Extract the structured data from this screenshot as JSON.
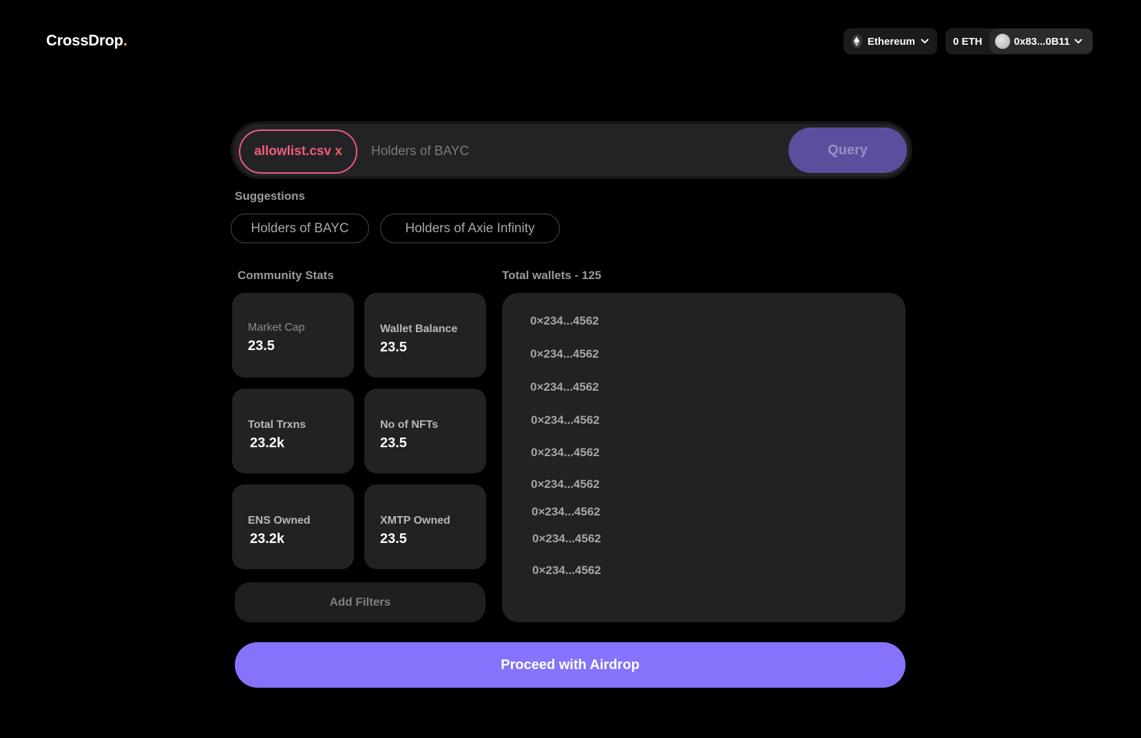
{
  "header": {
    "logo_text": "CrossDrop",
    "logo_dot": ".",
    "network_label": "Ethereum",
    "balance": "0 ETH",
    "wallet_address": "0x83...0B11"
  },
  "search": {
    "file_chip": "allowlist.csv x",
    "placeholder": "Holders of BAYC",
    "value": "",
    "query_label": "Query"
  },
  "suggestions": {
    "title": "Suggestions",
    "items": [
      "Holders of BAYC",
      "Holders of Axie Infinity"
    ]
  },
  "stats": {
    "title": "Community Stats",
    "cards": [
      {
        "label": "Market Cap",
        "value": "23.5"
      },
      {
        "label": "Wallet Balance",
        "value": "23.5"
      },
      {
        "label": "Total Trxns",
        "value": "23.2k"
      },
      {
        "label": "No of NFTs",
        "value": "23.5"
      },
      {
        "label": "ENS Owned",
        "value": "23.2k"
      },
      {
        "label": "XMTP Owned",
        "value": "23.5"
      }
    ],
    "add_filters_label": "Add Filters"
  },
  "wallets": {
    "title": "Total wallets - 125",
    "items": [
      "0×234...4562",
      "0×234...4562",
      "0×234...4562",
      "0×234...4562",
      "0×234...4562",
      "0×234...4562",
      "0×234...4562",
      "0×234...4562",
      "0×234...4562"
    ]
  },
  "airdrop_label": "Proceed with Airdrop",
  "colors": {
    "accent": "#8574fb",
    "query_button": "#5a4f9e",
    "file_chip": "#f25d7a",
    "logo_dot": "#f5c518",
    "background": "#000000",
    "card": "#222224"
  },
  "icons": {
    "network": "ethereum-icon",
    "dropdown": "chevron-down-icon",
    "avatar": "avatar"
  }
}
